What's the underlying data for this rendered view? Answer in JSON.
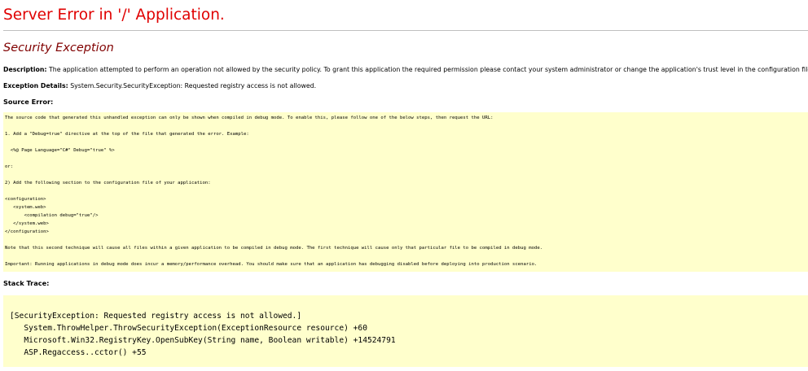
{
  "title": "Server Error in '/' Application.",
  "exception_heading": "Security Exception",
  "description": {
    "label": "Description:",
    "text": " The application attempted to perform an operation not allowed by the security policy.  To grant this application the required permission please contact your system administrator or change the application's trust level in the configuration file."
  },
  "exception_details": {
    "label": "Exception Details:",
    "text": " System.Security.SecurityException: Requested registry access is not allowed."
  },
  "source_error": {
    "label": "Source Error:",
    "lines": [
      "The source code that generated this unhandled exception can only be shown when compiled in debug mode. To enable this, please follow one of the below steps, then request the URL:",
      "1. Add a \"Debug=true\" directive at the top of the file that generated the error. Example:",
      "  <%@ Page Language=\"C#\" Debug=\"true\" %>",
      "or:",
      "2) Add the following section to the configuration file of your application:",
      "<configuration>",
      "   <system.web>",
      "       <compilation debug=\"true\"/>",
      "   </system.web>",
      "</configuration>",
      "Note that this second technique will cause all files within a given application to be compiled in debug mode. The first technique will cause only that particular file to be compiled in debug mode.",
      "Important: Running applications in debug mode does incur a memory/performance overhead. You should make sure that an application has debugging disabled before deploying into production scenario."
    ]
  },
  "stack_trace": {
    "label": "Stack Trace:",
    "lines": [
      "[SecurityException: Requested registry access is not allowed.]",
      "   System.ThrowHelper.ThrowSecurityException(ExceptionResource resource) +60",
      "   Microsoft.Win32.RegistryKey.OpenSubKey(String name, Boolean writable) +14524791",
      "   ASP.Regaccess..cctor() +55"
    ]
  }
}
